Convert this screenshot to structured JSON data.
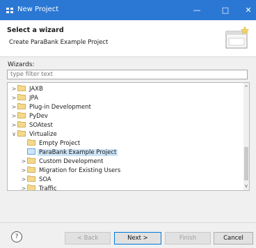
{
  "window": {
    "title": "New Project",
    "controls": {
      "minimize": "—",
      "maximize": "□",
      "close": "✕"
    }
  },
  "header": {
    "title": "Select a wizard",
    "description": "Create ParaBank Example Project"
  },
  "wizards_label": "Wizards:",
  "filter": {
    "placeholder": "type filter text",
    "value": ""
  },
  "tree": [
    {
      "label": "JAXB",
      "level": 0,
      "expanded": false,
      "selected": false
    },
    {
      "label": "JPA",
      "level": 0,
      "expanded": false,
      "selected": false
    },
    {
      "label": "Plug-in Development",
      "level": 0,
      "expanded": false,
      "selected": false
    },
    {
      "label": "PyDev",
      "level": 0,
      "expanded": false,
      "selected": false
    },
    {
      "label": "SOAtest",
      "level": 0,
      "expanded": false,
      "selected": false
    },
    {
      "label": "Virtualize",
      "level": 0,
      "expanded": true,
      "selected": false
    },
    {
      "label": "Empty Project",
      "level": 1,
      "leaf": true,
      "selected": false
    },
    {
      "label": "ParaBank Example Project",
      "level": 1,
      "leaf": true,
      "selected": true
    },
    {
      "label": "Custom Development",
      "level": 1,
      "expanded": false,
      "selected": false
    },
    {
      "label": "Migration for Existing Users",
      "level": 1,
      "expanded": false,
      "selected": false
    },
    {
      "label": "SOA",
      "level": 1,
      "expanded": false,
      "selected": false
    },
    {
      "label": "Traffic",
      "level": 1,
      "expanded": false,
      "selected": false
    }
  ],
  "buttons": {
    "help": "?",
    "back": "< Back",
    "next": "Next >",
    "finish": "Finish",
    "cancel": "Cancel"
  },
  "colors": {
    "titlebar": "#2b78d4",
    "selection": "#cce4f7",
    "folder": "#e8c46a"
  }
}
